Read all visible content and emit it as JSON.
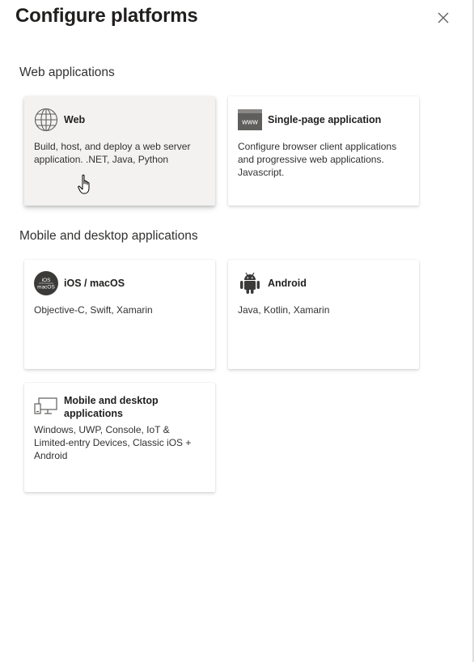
{
  "panel": {
    "title": "Configure platforms",
    "close_icon": "close-icon"
  },
  "sections": [
    {
      "label": "Web applications",
      "cards": [
        {
          "title": "Web",
          "description": "Build, host, and deploy a web server application. .NET, Java, Python",
          "icon": "globe-icon"
        },
        {
          "title": "Single-page application",
          "description": "Configure browser client applications and progressive web applications. Javascript.",
          "icon": "www-icon",
          "icon_text": "www"
        }
      ]
    },
    {
      "label": "Mobile and desktop applications",
      "cards": [
        {
          "title": "iOS / macOS",
          "description": "Objective-C, Swift, Xamarin",
          "icon": "apple-icon",
          "icon_text_1": "iOS",
          "icon_text_2": "macOS"
        },
        {
          "title": "Android",
          "description": "Java, Kotlin, Xamarin",
          "icon": "android-icon"
        },
        {
          "title": "Mobile and desktop applications",
          "description": "Windows, UWP, Console, IoT & Limited-entry Devices, Classic iOS + Android",
          "icon": "desktop-icon"
        }
      ]
    }
  ],
  "colors": {
    "hover_card": "#f3f2f1",
    "text": "#323130",
    "icon_dark": "#3b3a39"
  }
}
